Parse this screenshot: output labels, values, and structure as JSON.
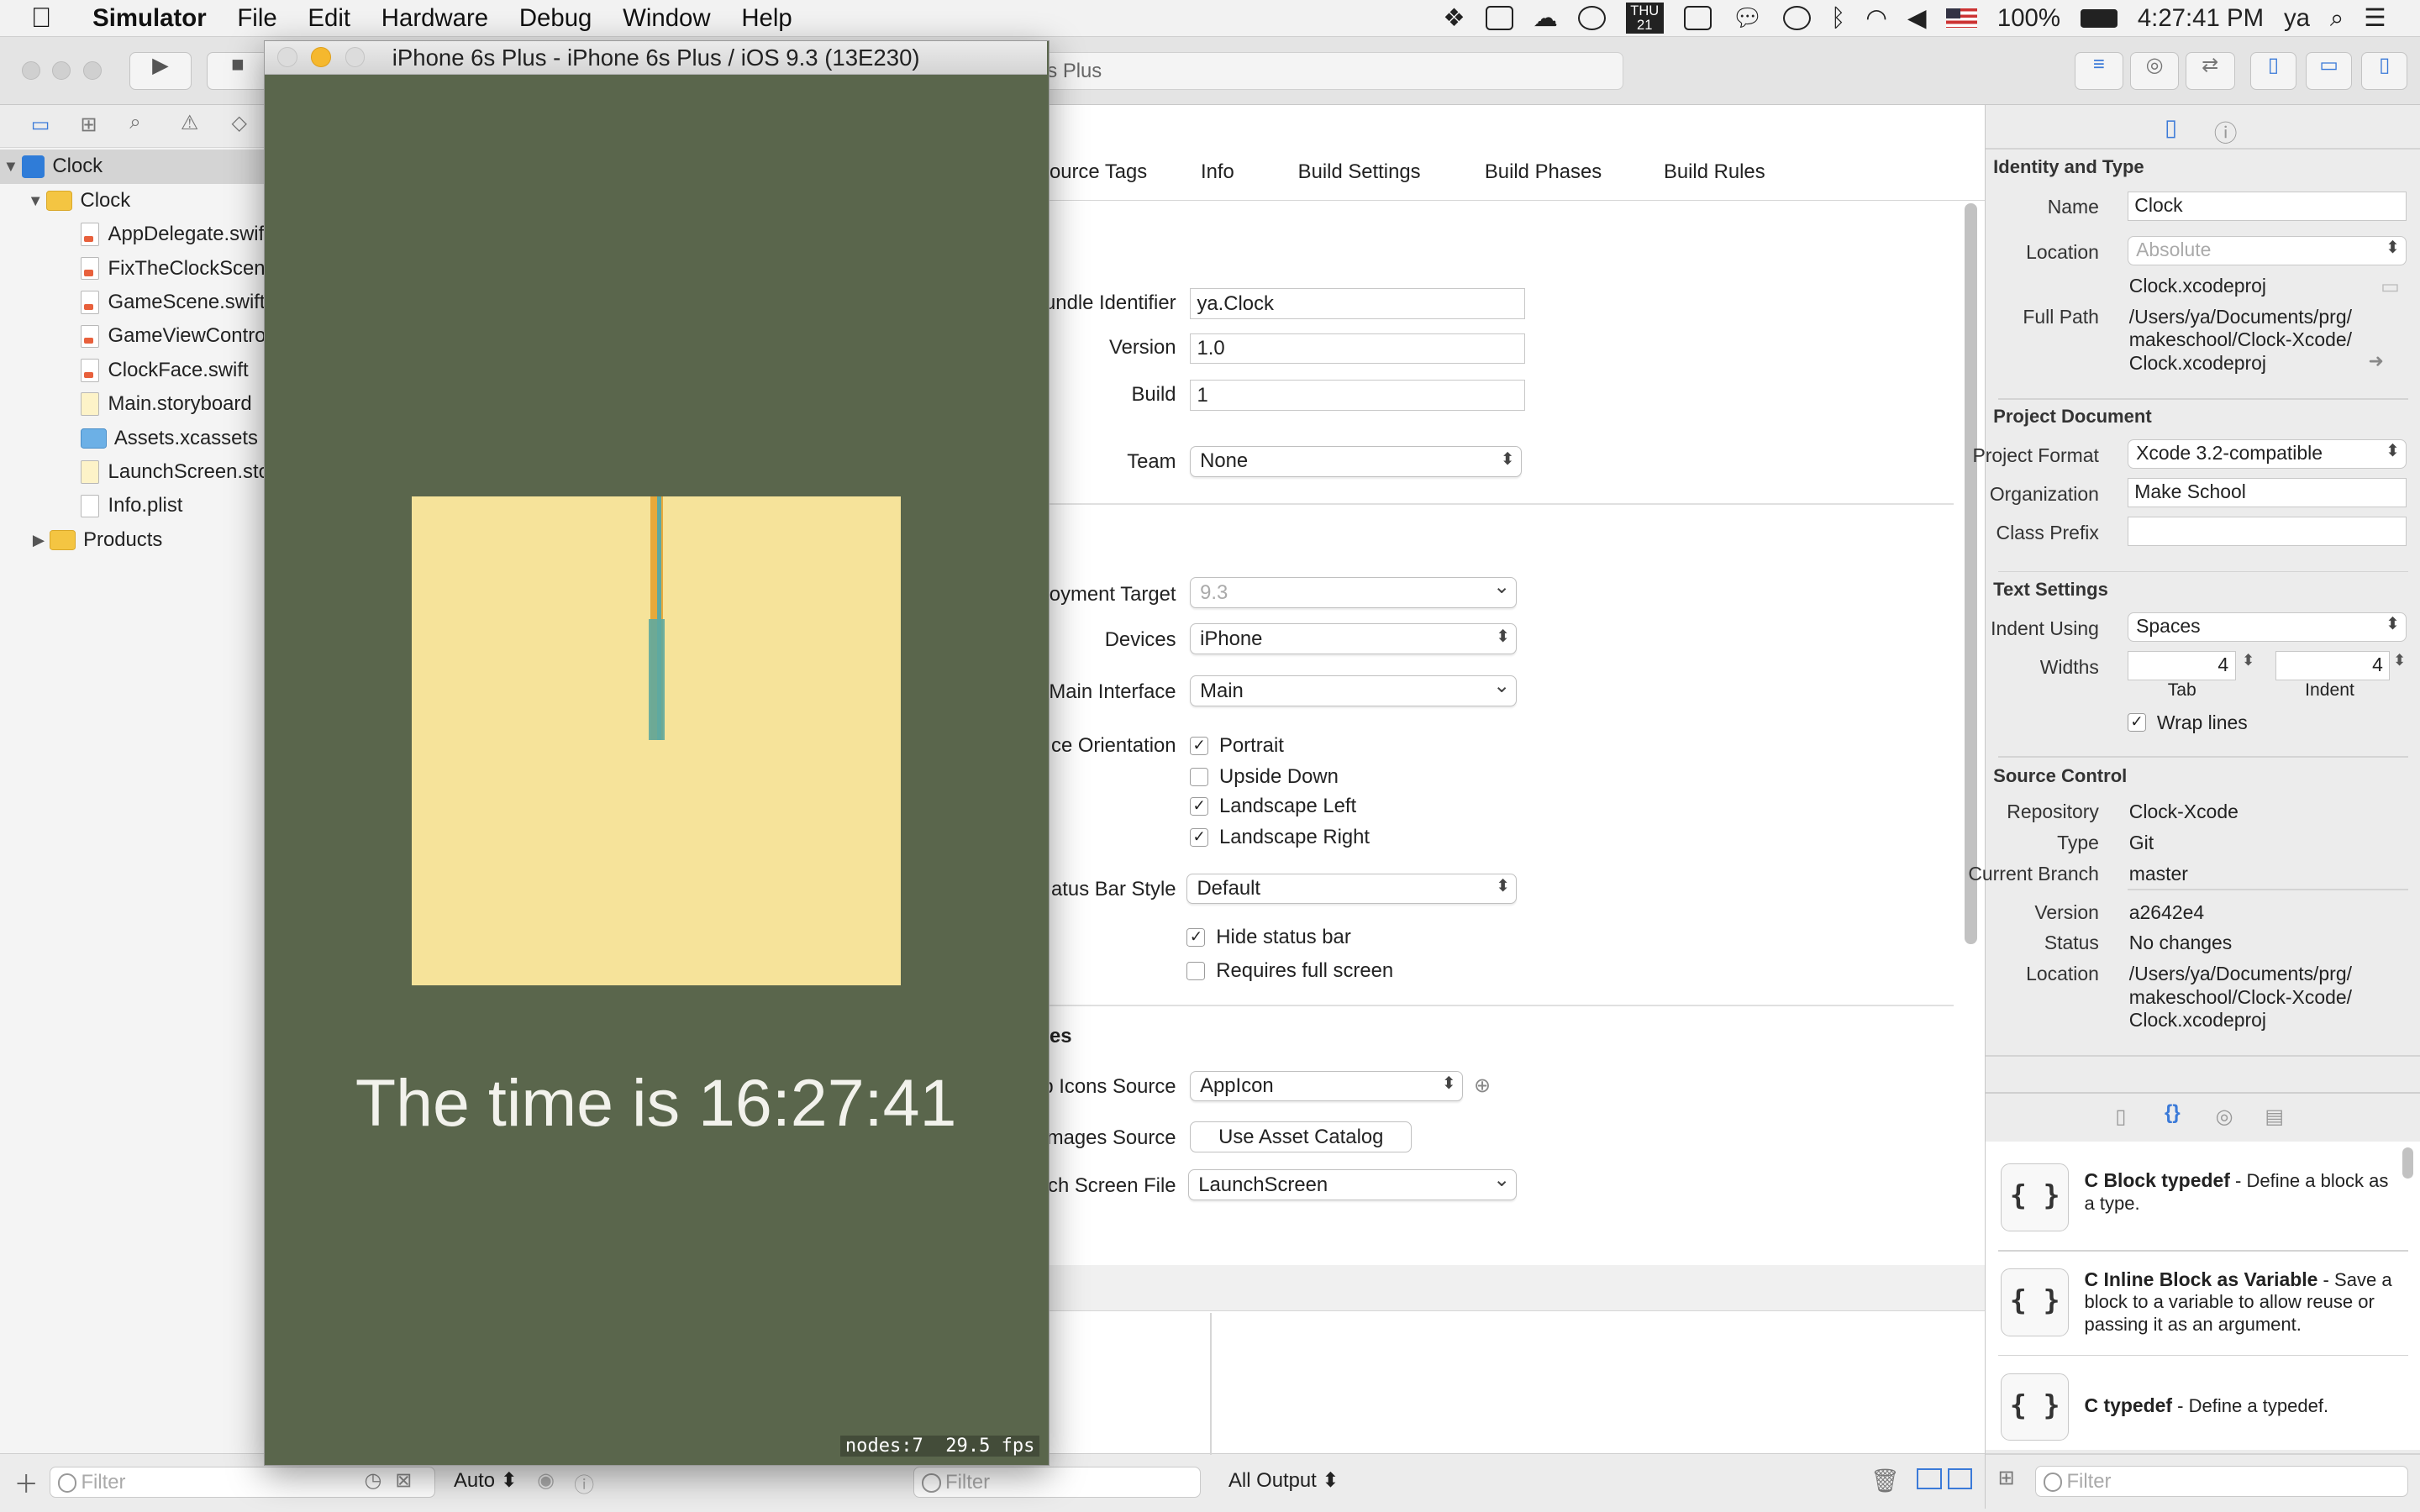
{
  "menubar": {
    "app": "Simulator",
    "menus": [
      "File",
      "Edit",
      "Hardware",
      "Debug",
      "Window",
      "Help"
    ],
    "calendar_day": "21",
    "calendar_weekday": "THU",
    "battery": "100%",
    "clock": "4:27:41 PM",
    "user": "ya"
  },
  "toolbar": {
    "scheme_partial": "s Plus"
  },
  "navigator": {
    "project": "Clock",
    "group": "Clock",
    "files": [
      "AppDelegate.swift",
      "FixTheClockScene.swift",
      "GameScene.swift",
      "GameViewController.swift",
      "ClockFace.swift",
      "Main.storyboard",
      "Assets.xcassets",
      "LaunchScreen.storyboard",
      "Info.plist"
    ],
    "products": "Products",
    "filter_placeholder": "Filter"
  },
  "editor": {
    "tabs": [
      "ource Tags",
      "Info",
      "Build Settings",
      "Build Phases",
      "Build Rules"
    ],
    "identity": {
      "bundle_label": "undle Identifier",
      "bundle_value": "ya.Clock",
      "version_label": "Version",
      "version_value": "1.0",
      "build_label": "Build",
      "build_value": "1",
      "team_label": "Team",
      "team_value": "None"
    },
    "deployment": {
      "target_label": "oyment Target",
      "target_value": "9.3",
      "devices_label": "Devices",
      "devices_value": "iPhone",
      "interface_label": "Main Interface",
      "interface_value": "Main",
      "orientation_label": "ce Orientation",
      "orientations": [
        {
          "label": "Portrait",
          "checked": true
        },
        {
          "label": "Upside Down",
          "checked": false
        },
        {
          "label": "Landscape Left",
          "checked": true
        },
        {
          "label": "Landscape Right",
          "checked": true
        }
      ],
      "statusbar_label": "atus Bar Style",
      "statusbar_value": "Default",
      "hide_status": "Hide status bar",
      "full_screen": "Requires full screen"
    },
    "icons": {
      "section": "es",
      "icons_label": "p Icons Source",
      "icons_value": "AppIcon",
      "images_label": "mages Source",
      "images_button": "Use Asset Catalog",
      "launch_label": "nch Screen File",
      "launch_value": "LaunchScreen"
    }
  },
  "debug": {
    "auto": "Auto",
    "filter": "Filter",
    "output": "All Output"
  },
  "inspector": {
    "identity_title": "Identity and Type",
    "name_label": "Name",
    "name_value": "Clock",
    "location_label": "Location",
    "location_value": "Absolute",
    "filename": "Clock.xcodeproj",
    "fullpath_label": "Full Path",
    "fullpath_lines": [
      "/Users/ya/Documents/prg/",
      "makeschool/Clock-Xcode/",
      "Clock.xcodeproj"
    ],
    "projdoc_title": "Project Document",
    "format_label": "Project Format",
    "format_value": "Xcode 3.2-compatible",
    "org_label": "Organization",
    "org_value": "Make School",
    "prefix_label": "Class Prefix",
    "prefix_value": "",
    "text_title": "Text Settings",
    "indent_label": "Indent Using",
    "indent_value": "Spaces",
    "widths_label": "Widths",
    "tab_value": "4",
    "indent_width_value": "4",
    "tab_caption": "Tab",
    "indent_caption": "Indent",
    "wrap_label": "Wrap lines",
    "sc_title": "Source Control",
    "repo_label": "Repository",
    "repo_value": "Clock-Xcode",
    "type_label": "Type",
    "type_value": "Git",
    "branch_label": "Current Branch",
    "branch_value": "master",
    "version_label": "Version",
    "version_value": "a2642e4",
    "status_label": "Status",
    "status_value": "No changes",
    "loc_label": "Location",
    "loc_lines": [
      "/Users/ya/Documents/prg/",
      "makeschool/Clock-Xcode/",
      "Clock.xcodeproj"
    ],
    "snippets": [
      {
        "title": "C Block typedef",
        "desc": " - Define a block as a type."
      },
      {
        "title": "C Inline Block as Variable",
        "desc": " - Save a block to a variable to allow reuse or passing it as an argument."
      },
      {
        "title": "C typedef",
        "desc": " - Define a typedef."
      }
    ],
    "filter": "Filter"
  },
  "simulator": {
    "title": "iPhone 6s Plus - iPhone 6s Plus / iOS 9.3 (13E230)",
    "time_text": "The time is 16:27:41",
    "stats": "nodes:7  29.5 fps",
    "colors": {
      "background": "#5a664c",
      "face": "#f6e39a",
      "hand_orange": "#e8a93a",
      "hand_teal": "#5fa8a0"
    }
  }
}
